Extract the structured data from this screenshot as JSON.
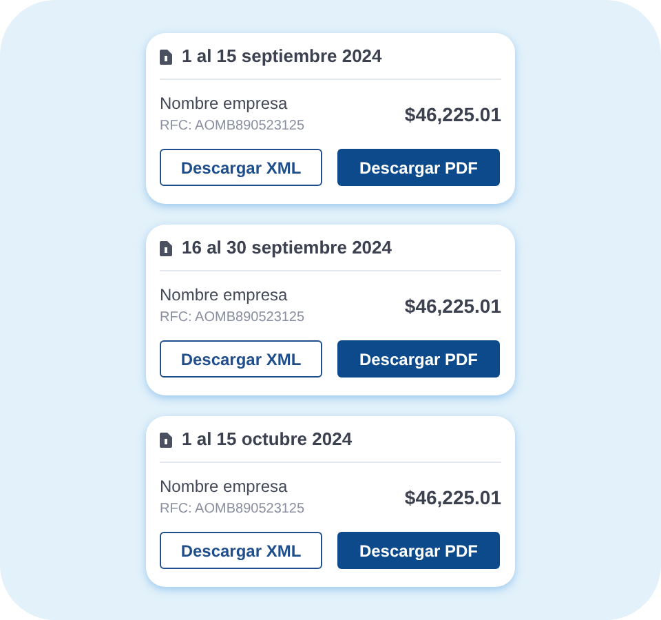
{
  "invoices": [
    {
      "period": "1 al 15 septiembre 2024",
      "company": "Nombre empresa",
      "rfc": "RFC: AOMB890523125",
      "amount": "$46,225.01",
      "buttons": [
        "Descargar XML",
        "Descargar PDF"
      ]
    },
    {
      "period": "16 al 30 septiembre 2024",
      "company": "Nombre empresa",
      "rfc": "RFC: AOMB890523125",
      "amount": "$46,225.01",
      "buttons": [
        "Descargar XML",
        "Descargar PDF"
      ]
    },
    {
      "period": "1 al 15 octubre 2024",
      "company": "Nombre empresa",
      "rfc": "RFC: AOMB890523125",
      "amount": "$46,225.01",
      "buttons": [
        "Descargar XML",
        "Descargar PDF"
      ]
    }
  ]
}
